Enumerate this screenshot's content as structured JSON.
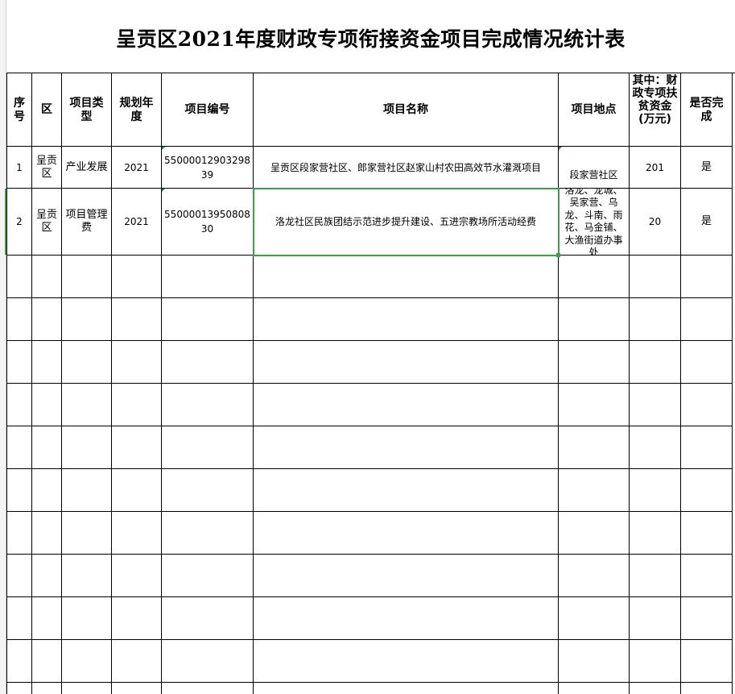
{
  "title": "呈贡区2021年度财政专项衔接资金项目完成情况统计表",
  "headers": {
    "seq": "序号",
    "district": "区",
    "type": "项目类型",
    "plan_year": "规划年度",
    "code": "项目编号",
    "name": "项目名称",
    "location": "项目地点",
    "fund": "其中：财政专项扶贫资金(万元)",
    "completed": "是否完成"
  },
  "rows": [
    {
      "seq": "1",
      "district": "呈贡区",
      "type": "产业发展",
      "plan_year": "2021",
      "code": "5500001290329839",
      "name": "呈贡区段家营社区、郎家营社区赵家山村农田高效节水灌溉项目",
      "location": "段家营社区",
      "fund": "201",
      "completed": "是"
    },
    {
      "seq": "2",
      "district": "呈贡区",
      "type": "项目管理费",
      "plan_year": "2021",
      "code": "5500001395080830",
      "name": "洛龙社区民族团结示范进步提升建设、五进宗教场所活动经费",
      "location": "洛龙、龙城、吴家营、乌龙、斗南、雨花、马金铺、大渔街道办事处",
      "fund": "20",
      "completed": "是"
    }
  ],
  "colors": {
    "grid": "#000000",
    "selection": "#3aa043",
    "cell_marker": "#1c8a3a"
  }
}
